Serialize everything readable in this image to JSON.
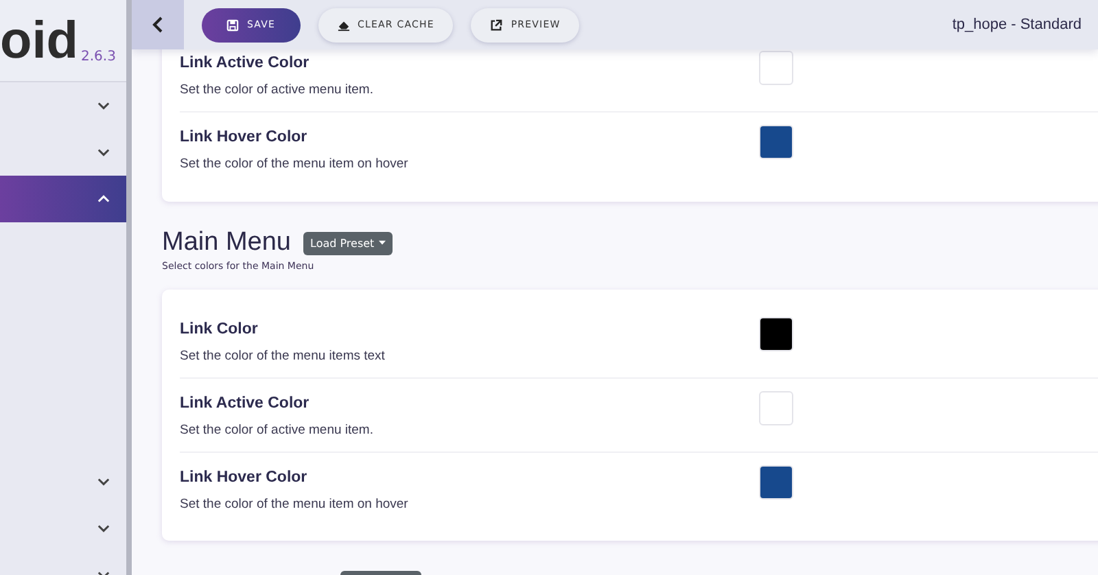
{
  "sidebar": {
    "logo": "oid",
    "version": "2.6.3",
    "items": [
      {
        "selected": false,
        "expanded": false
      },
      {
        "selected": false,
        "expanded": false
      },
      {
        "selected": true,
        "expanded": true
      },
      {
        "selected": false,
        "expanded": false
      },
      {
        "selected": false,
        "expanded": false
      },
      {
        "selected": false,
        "expanded": false
      }
    ]
  },
  "toolbar": {
    "buttons": [
      {
        "label": "SAVE",
        "kind": "save"
      },
      {
        "label": "CLEAR CACHE",
        "kind": "clear"
      },
      {
        "label": "PREVIEW",
        "kind": "preview"
      }
    ],
    "template": "tp_hope - Standard"
  },
  "sections": [
    {
      "rows": [
        {
          "title": "Link Active Color",
          "description": "Set the color of active menu item.",
          "color": "#ffffff"
        },
        {
          "title": "Link Hover Color",
          "description": "Set the color of the menu item on hover",
          "color": "#17498d"
        }
      ]
    },
    {
      "title": "Main Menu",
      "preset": "Load Preset",
      "subtitle": "Select colors for the Main Menu",
      "rows": [
        {
          "title": "Link Color",
          "description": "Set the color of the menu items text",
          "color": "#000000"
        },
        {
          "title": "Link Active Color",
          "description": "Set the color of active menu item.",
          "color": "#ffffff"
        },
        {
          "title": "Link Hover Color",
          "description": "Set the color of the menu item on hover",
          "color": "#17498d"
        }
      ]
    }
  ]
}
